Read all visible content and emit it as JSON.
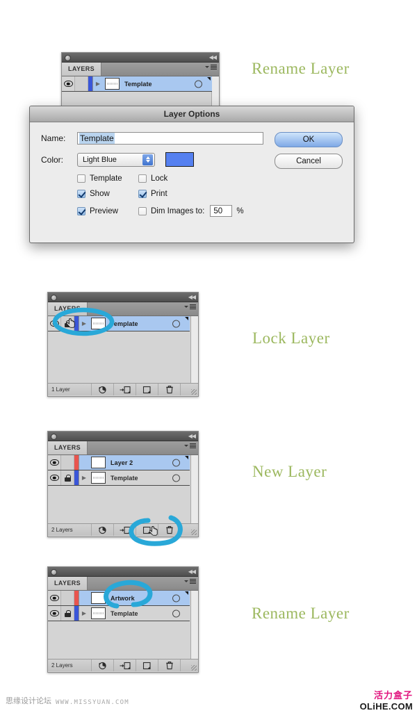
{
  "page": {
    "background": "#ffffff",
    "accent_green": "#9cb85f",
    "accent_blue": "#29a8d8"
  },
  "annotations": [
    {
      "label": "Rename Layer",
      "name": "annotation-rename-layer-top"
    },
    {
      "label": "Lock Layer",
      "name": "annotation-lock-layer"
    },
    {
      "label": "New Layer",
      "name": "annotation-new-layer"
    },
    {
      "label": "Rename Layer",
      "name": "annotation-rename-layer-bottom"
    }
  ],
  "panels": {
    "top": {
      "tab_label": "LAYERS",
      "rows": [
        {
          "name": "Template",
          "color": "#3a56d8",
          "selected": true,
          "has_disclosure": true,
          "locked": false,
          "visible": true
        }
      ]
    },
    "lock": {
      "tab_label": "LAYERS",
      "footer_count": "1 Layer",
      "rows": [
        {
          "name": "Template",
          "color": "#3a56d8",
          "selected": true,
          "has_disclosure": true,
          "locked": true,
          "visible": true
        }
      ]
    },
    "new": {
      "tab_label": "LAYERS",
      "footer_count": "2 Layers",
      "rows": [
        {
          "name": "Layer 2",
          "color": "#e8554e",
          "selected": true,
          "has_disclosure": false,
          "locked": false,
          "visible": true
        },
        {
          "name": "Template",
          "color": "#3a56d8",
          "selected": false,
          "has_disclosure": true,
          "locked": true,
          "visible": true
        }
      ]
    },
    "artwork": {
      "tab_label": "LAYERS",
      "footer_count": "2 Layers",
      "rows": [
        {
          "name": "Artwork",
          "color": "#e8554e",
          "selected": true,
          "has_disclosure": false,
          "locked": false,
          "visible": true
        },
        {
          "name": "Template",
          "color": "#3a56d8",
          "selected": false,
          "has_disclosure": true,
          "locked": true,
          "visible": true
        }
      ]
    }
  },
  "footer_tools": [
    {
      "icon": "clipping-mask-icon",
      "label": "Make/Release Clipping Mask"
    },
    {
      "icon": "new-sublayer-icon",
      "label": "Create New Sublayer"
    },
    {
      "icon": "new-layer-icon",
      "label": "Create New Layer"
    },
    {
      "icon": "trash-icon",
      "label": "Delete Selection"
    }
  ],
  "dialog": {
    "title": "Layer Options",
    "name_label": "Name:",
    "name_value": "Template",
    "color_label": "Color:",
    "color_value": "Light Blue",
    "color_swatch": "#5580f0",
    "ok_label": "OK",
    "cancel_label": "Cancel",
    "checkboxes": [
      {
        "label": "Template",
        "checked": false
      },
      {
        "label": "Lock",
        "checked": false
      },
      {
        "label": "Show",
        "checked": true
      },
      {
        "label": "Print",
        "checked": true
      },
      {
        "label": "Preview",
        "checked": true
      },
      {
        "label": "Dim Images to:",
        "checked": false
      }
    ],
    "dim_value": "50",
    "dim_unit": "%"
  },
  "watermarks": {
    "left_cn": "思缘设计论坛",
    "left_url": "WWW.MISSYUAN.COM",
    "right_cn": "活力盒子",
    "right_url": "OLiHE.COM"
  }
}
